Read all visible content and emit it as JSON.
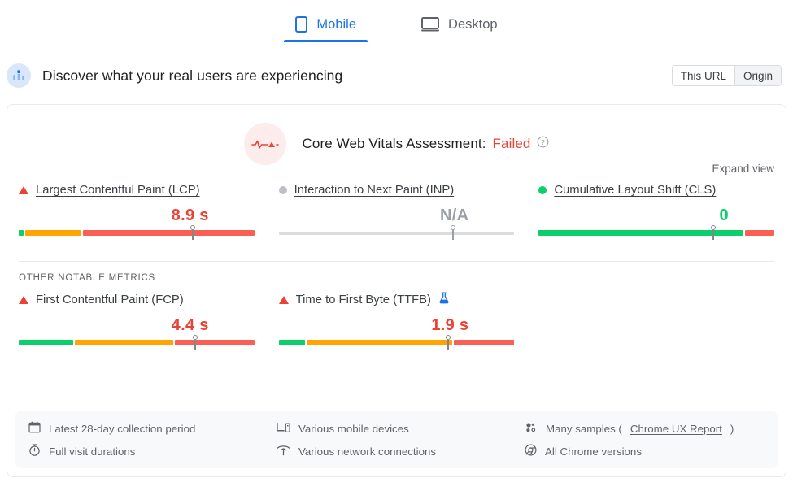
{
  "tabs": [
    {
      "label": "Mobile",
      "icon": "mobile-icon",
      "active": true
    },
    {
      "label": "Desktop",
      "icon": "desktop-icon",
      "active": false
    }
  ],
  "discover": {
    "icon": "real-user-data-icon",
    "title": "Discover what your real users are experiencing",
    "scope_toggle": {
      "this_url": "This URL",
      "origin": "Origin",
      "selected": "This URL"
    }
  },
  "assessment": {
    "icon": "failed-pulse-icon",
    "label": "Core Web Vitals Assessment:",
    "status": "Failed",
    "help_icon": "help-circle-icon",
    "status_color": "#ea4335"
  },
  "expand_view": "Expand view",
  "other_metrics_label": "OTHER NOTABLE METRICS",
  "core_metrics": [
    {
      "name": "Largest Contentful Paint (LCP)",
      "status_icon": "red-triangle-icon",
      "status": "fail",
      "value": "8.9 s",
      "value_color": "#ea4335",
      "marker_pct": 74,
      "segments": [
        {
          "color": "#0cce6b",
          "pct": 2
        },
        {
          "color": "#ffa400",
          "pct": 24
        },
        {
          "color": "#f95f53",
          "pct": 74
        }
      ]
    },
    {
      "name": "Interaction to Next Paint (INP)",
      "status_icon": "grey-dot-icon",
      "status": "none",
      "value": "N/A",
      "value_color": "#9aa0a6",
      "marker_pct": 74,
      "segments": [
        {
          "color": "#dadce0",
          "pct": 100
        }
      ]
    },
    {
      "name": "Cumulative Layout Shift (CLS)",
      "status_icon": "green-dot-icon",
      "status": "pass",
      "value": "0",
      "value_color": "#0cce6b",
      "marker_pct": 74,
      "segments": [
        {
          "color": "#0cce6b",
          "pct": 87
        },
        {
          "color": "#f95f53",
          "pct": 13
        }
      ]
    }
  ],
  "other_notable_metrics": [
    {
      "name": "First Contentful Paint (FCP)",
      "status_icon": "red-triangle-icon",
      "status": "fail",
      "value": "4.4 s",
      "value_color": "#ea4335",
      "marker_pct": 75,
      "badge_icon": "",
      "segments": [
        {
          "color": "#0cce6b",
          "pct": 23
        },
        {
          "color": "#ffa400",
          "pct": 42
        },
        {
          "color": "#f95f53",
          "pct": 35
        }
      ]
    },
    {
      "name": "Time to First Byte (TTFB)",
      "status_icon": "red-triangle-icon",
      "status": "fail",
      "value": "1.9 s",
      "value_color": "#ea4335",
      "marker_pct": 72,
      "badge_icon": "experimental-flask-icon",
      "segments": [
        {
          "color": "#0cce6b",
          "pct": 11
        },
        {
          "color": "#ffa400",
          "pct": 62
        },
        {
          "color": "#f95f53",
          "pct": 27
        }
      ]
    }
  ],
  "footer": [
    {
      "icon": "calendar-icon",
      "text": "Latest 28-day collection period",
      "link": ""
    },
    {
      "icon": "devices-icon",
      "text": "Various mobile devices",
      "link": ""
    },
    {
      "icon": "samples-icon",
      "text": "Many samples (",
      "link": "Chrome UX Report",
      "suffix": ")"
    },
    {
      "icon": "timer-icon",
      "text": "Full visit durations",
      "link": ""
    },
    {
      "icon": "wifi-icon",
      "text": "Various network connections",
      "link": ""
    },
    {
      "icon": "chrome-icon",
      "text": "All Chrome versions",
      "link": ""
    }
  ]
}
